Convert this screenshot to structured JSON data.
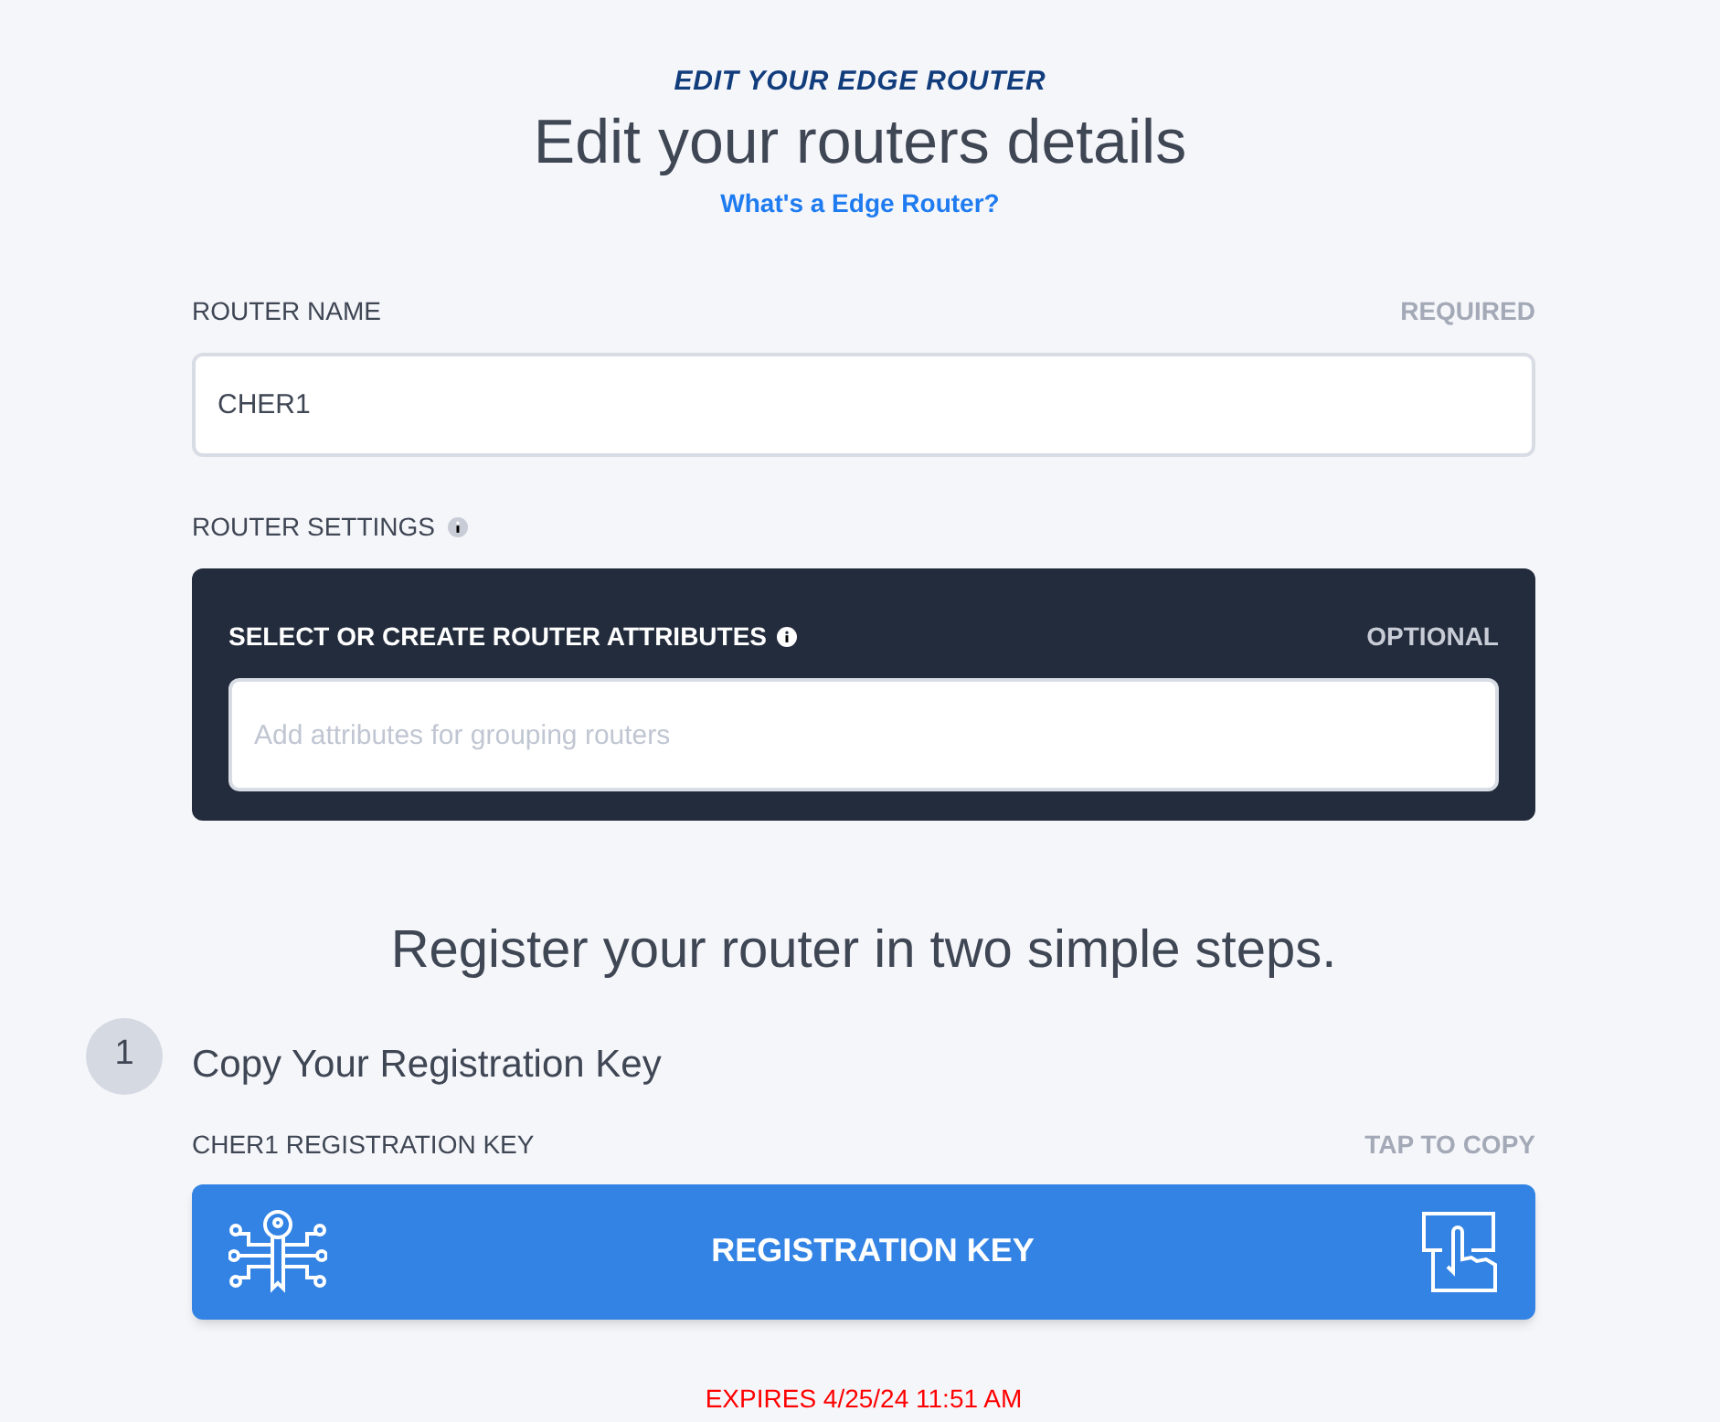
{
  "header": {
    "eyebrow": "EDIT YOUR EDGE ROUTER",
    "title": "Edit your routers details",
    "help_link": "What's a Edge Router?"
  },
  "router_name": {
    "label": "ROUTER NAME",
    "hint": "REQUIRED",
    "value": "CHER1"
  },
  "router_settings": {
    "label": "ROUTER SETTINGS",
    "panel_label": "SELECT OR CREATE ROUTER ATTRIBUTES",
    "panel_hint": "OPTIONAL",
    "placeholder": "Add attributes for grouping routers"
  },
  "register": {
    "heading": "Register your router in two simple steps.",
    "steps": [
      {
        "number": "1",
        "title": "Copy Your Registration Key",
        "key_label": "CHER1 REGISTRATION KEY",
        "key_hint": "TAP TO COPY",
        "button": "REGISTRATION KEY",
        "expires": "EXPIRES 4/25/24 11:51 AM"
      }
    ]
  }
}
